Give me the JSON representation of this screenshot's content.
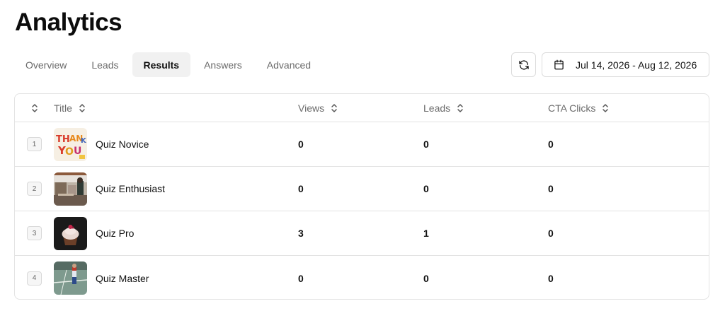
{
  "page": {
    "title": "Analytics"
  },
  "tabs": [
    {
      "label": "Overview",
      "active": false
    },
    {
      "label": "Leads",
      "active": false
    },
    {
      "label": "Results",
      "active": true
    },
    {
      "label": "Answers",
      "active": false
    },
    {
      "label": "Advanced",
      "active": false
    }
  ],
  "toolbar": {
    "refresh_icon": "refresh-icon",
    "calendar_icon": "calendar-icon",
    "date_range": "Jul 14, 2026 - Aug 12, 2026"
  },
  "table": {
    "columns": {
      "title": "Title",
      "views": "Views",
      "leads": "Leads",
      "cta": "CTA Clicks"
    },
    "rows": [
      {
        "index": "1",
        "title": "Quiz Novice",
        "views": "0",
        "leads": "0",
        "cta": "0",
        "thumb": "thank-you-image"
      },
      {
        "index": "2",
        "title": "Quiz Enthusiast",
        "views": "0",
        "leads": "0",
        "cta": "0",
        "thumb": "cafe-image"
      },
      {
        "index": "3",
        "title": "Quiz Pro",
        "views": "3",
        "leads": "1",
        "cta": "0",
        "thumb": "cupcake-image"
      },
      {
        "index": "4",
        "title": "Quiz Master",
        "views": "0",
        "leads": "0",
        "cta": "0",
        "thumb": "tennis-court-image"
      }
    ]
  }
}
